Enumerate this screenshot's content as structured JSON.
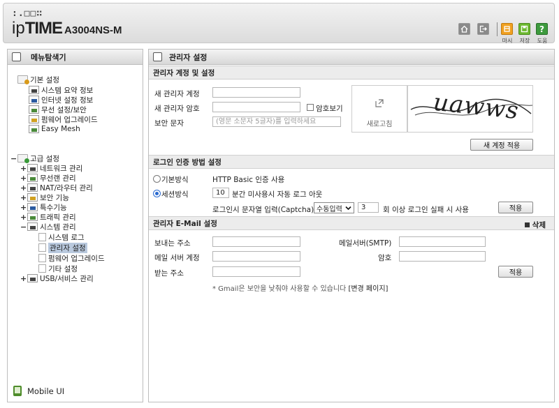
{
  "header": {
    "logo_dots": ":.□□∷",
    "logo_ip": "ip",
    "logo_time": "TIME",
    "logo_model": "A3004NS-M",
    "buttons": [
      {
        "icon": "home-icon",
        "label": ""
      },
      {
        "icon": "logout-icon",
        "label": ""
      },
      {
        "icon": "restore-icon",
        "label": "마시"
      },
      {
        "icon": "save-icon",
        "label": "저장"
      },
      {
        "icon": "help-icon",
        "label": "도움"
      }
    ]
  },
  "sidebar": {
    "title": "메뉴탐색기",
    "basic": {
      "label": "기본 설정",
      "items": [
        "시스템 요약 정보",
        "인터넷 설정 정보",
        "무선 설정/보안",
        "펌웨어 업그레이드",
        "Easy Mesh"
      ]
    },
    "advanced": {
      "toggle": "−",
      "label": "고급 설정",
      "items": [
        {
          "toggle": "+",
          "label": "네트워크 관리"
        },
        {
          "toggle": "+",
          "label": "무선랜 관리"
        },
        {
          "toggle": "+",
          "label": "NAT/라우터 관리"
        },
        {
          "toggle": "+",
          "label": "보안 기능"
        },
        {
          "toggle": "+",
          "label": "특수기능"
        },
        {
          "toggle": "+",
          "label": "트래픽 관리"
        },
        {
          "toggle": "−",
          "label": "시스템 관리"
        }
      ],
      "system_children": [
        "시스템 로그",
        "관리자 설정",
        "펌웨어 업그레이드",
        "기타 설정"
      ],
      "usb": {
        "toggle": "+",
        "label": "USB/서비스 관리"
      }
    },
    "mobile_ui": "Mobile UI"
  },
  "main": {
    "title": "관리자 설정",
    "account": {
      "header": "관리자 계정 및 설정",
      "new_id_label": "새 관리자 계정",
      "new_id_value": "",
      "new_pw_label": "새 관리자 암호",
      "new_pw_value": "",
      "show_pw_label": "암호보기",
      "captcha_label": "보안 문자",
      "captcha_placeholder": "(영문 소문자 5글자)를 입력하세요",
      "refresh_label": "새로고침",
      "captcha_text": "uawws",
      "apply_label": "새 계정 적용"
    },
    "login": {
      "header": "로그인 인증 방법 설정",
      "basic_label": "기본방식",
      "basic_desc": "HTTP Basic 인증 사용",
      "session_label": "세션방식",
      "timeout_value": "10",
      "timeout_desc": "분간 미사용시 자동 로그 아웃",
      "captcha_desc": "로그인시 문자열 입력(Captcha)",
      "captcha_mode": "수동입력",
      "fail_count": "3",
      "fail_desc": "회 이상 로그인 실패 시 사용",
      "apply_label": "적용"
    },
    "email": {
      "header": "관리자 E-Mail 설정",
      "delete_label": "삭제",
      "sender_label": "보내는 주소",
      "sender_value": "",
      "smtp_label": "메일서버(SMTP)",
      "smtp_value": "",
      "account_label": "메일 서버 계정",
      "account_value": "",
      "pw_label": "암호",
      "pw_value": "",
      "recipient_label": "받는 주소",
      "recipient_value": "",
      "apply_label": "적용",
      "note": "* Gmail은 보안을 낮춰야 사용할 수 있습니다",
      "note_link": "[변경 페이지]"
    }
  }
}
